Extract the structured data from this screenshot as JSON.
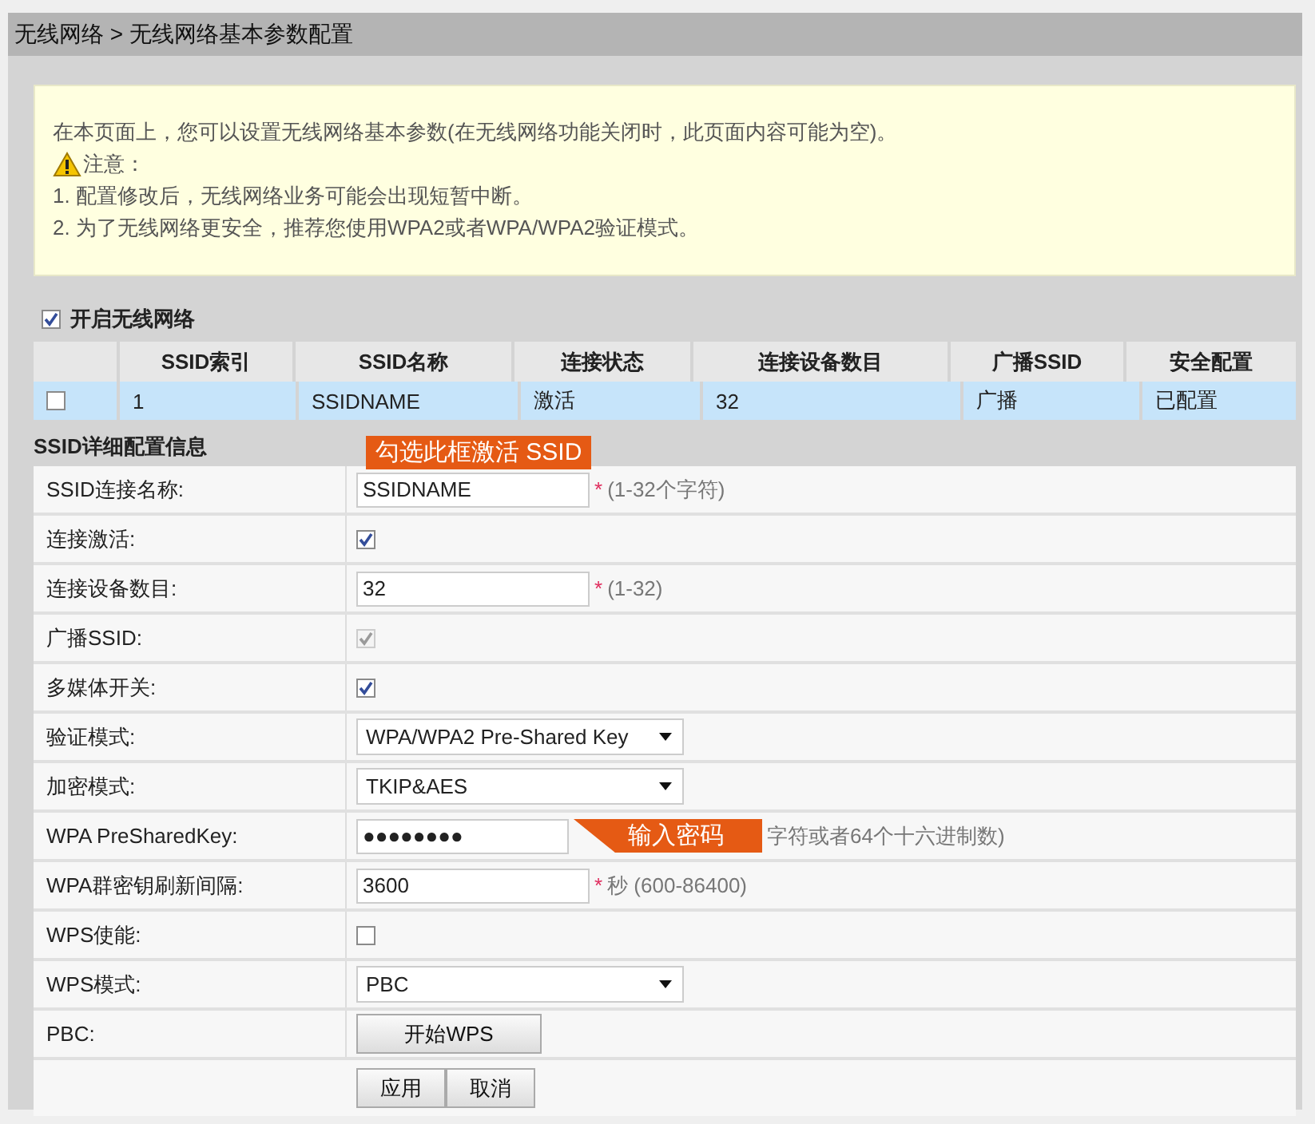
{
  "breadcrumb": "无线网络 > 无线网络基本参数配置",
  "notice": {
    "lines": [
      "在本页面上，您可以设置无线网络基本参数(在无线网络功能关闭时，此页面内容可能为空)。",
      "1. 配置修改后，无线网络业务可能会出现短暂中断。",
      "2. 为了无线网络更安全，推荐您使用WPA2或者WPA/WPA2验证模式。"
    ],
    "warning": "注意："
  },
  "enable_wireless": {
    "label": "开启无线网络",
    "checked": true
  },
  "ssid_table": {
    "columns": [
      "SSID索引",
      "SSID名称",
      "连接状态",
      "连接设备数目",
      "广播SSID",
      "安全配置"
    ],
    "rows": [
      {
        "checked": false,
        "selected": true,
        "cells": [
          "1",
          "SSIDNAME",
          "激活",
          "32",
          "广播",
          "已配置"
        ]
      }
    ]
  },
  "section_title": "SSID详细配置信息",
  "fields": [
    {
      "kind": "text",
      "label": "SSID连接名称:",
      "value": "SSIDNAME",
      "required_mark": "*",
      "hint": "(1-32个字符)",
      "callout": "勾选此框激活 SSID"
    },
    {
      "kind": "checkbox",
      "label": "连接激活:",
      "checked": true,
      "disabled": false
    },
    {
      "kind": "text",
      "label": "连接设备数目:",
      "value": "32",
      "required_mark": "*",
      "hint": "(1-32)"
    },
    {
      "kind": "checkbox",
      "label": "广播SSID:",
      "checked": true,
      "disabled": true
    },
    {
      "kind": "checkbox",
      "label": "多媒体开关:",
      "checked": true,
      "disabled": false
    },
    {
      "kind": "select",
      "label": "验证模式:",
      "value": "WPA/WPA2 Pre-Shared Key"
    },
    {
      "kind": "select",
      "label": "加密模式:",
      "value": "TKIP&AES"
    },
    {
      "kind": "password",
      "label": "WPA PreSharedKey:",
      "value": "●●●●●●●●",
      "hint": "字符或者64个十六进制数)",
      "callout": "输入密码"
    },
    {
      "kind": "text",
      "label": "WPA群密钥刷新间隔:",
      "value": "3600",
      "required_mark": "*",
      "hint": "秒  (600-86400)"
    },
    {
      "kind": "checkbox",
      "label": "WPS使能:",
      "checked": false,
      "disabled": false
    },
    {
      "kind": "select",
      "label": "WPS模式:",
      "value": "PBC"
    },
    {
      "kind": "button",
      "label": "PBC:",
      "value": "开始WPS"
    }
  ],
  "actions": [
    "应用",
    "取消"
  ]
}
